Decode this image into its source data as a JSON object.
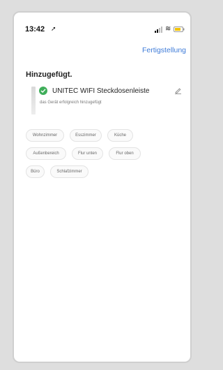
{
  "status": {
    "time": "13:42"
  },
  "header": {
    "done_label": "Fertigstellung"
  },
  "page": {
    "title": "Hinzugefügt."
  },
  "device": {
    "name": "UNITEC WIFI Steckdosenleiste",
    "subtitle": "das Gerät erfolgreich hinzugefügt"
  },
  "rooms": [
    "Wohnzimmer",
    "Esszimmer",
    "Küche",
    "Außenbereich",
    "Flur unten",
    "Flur oben",
    "Büro",
    "Schlafzimmer"
  ],
  "colors": {
    "accent": "#3e7bd8",
    "success": "#3fae5a"
  },
  "icons": [
    "location-arrow-icon",
    "signal-icon",
    "wifi-icon",
    "battery-icon",
    "check-icon",
    "edit-icon"
  ]
}
